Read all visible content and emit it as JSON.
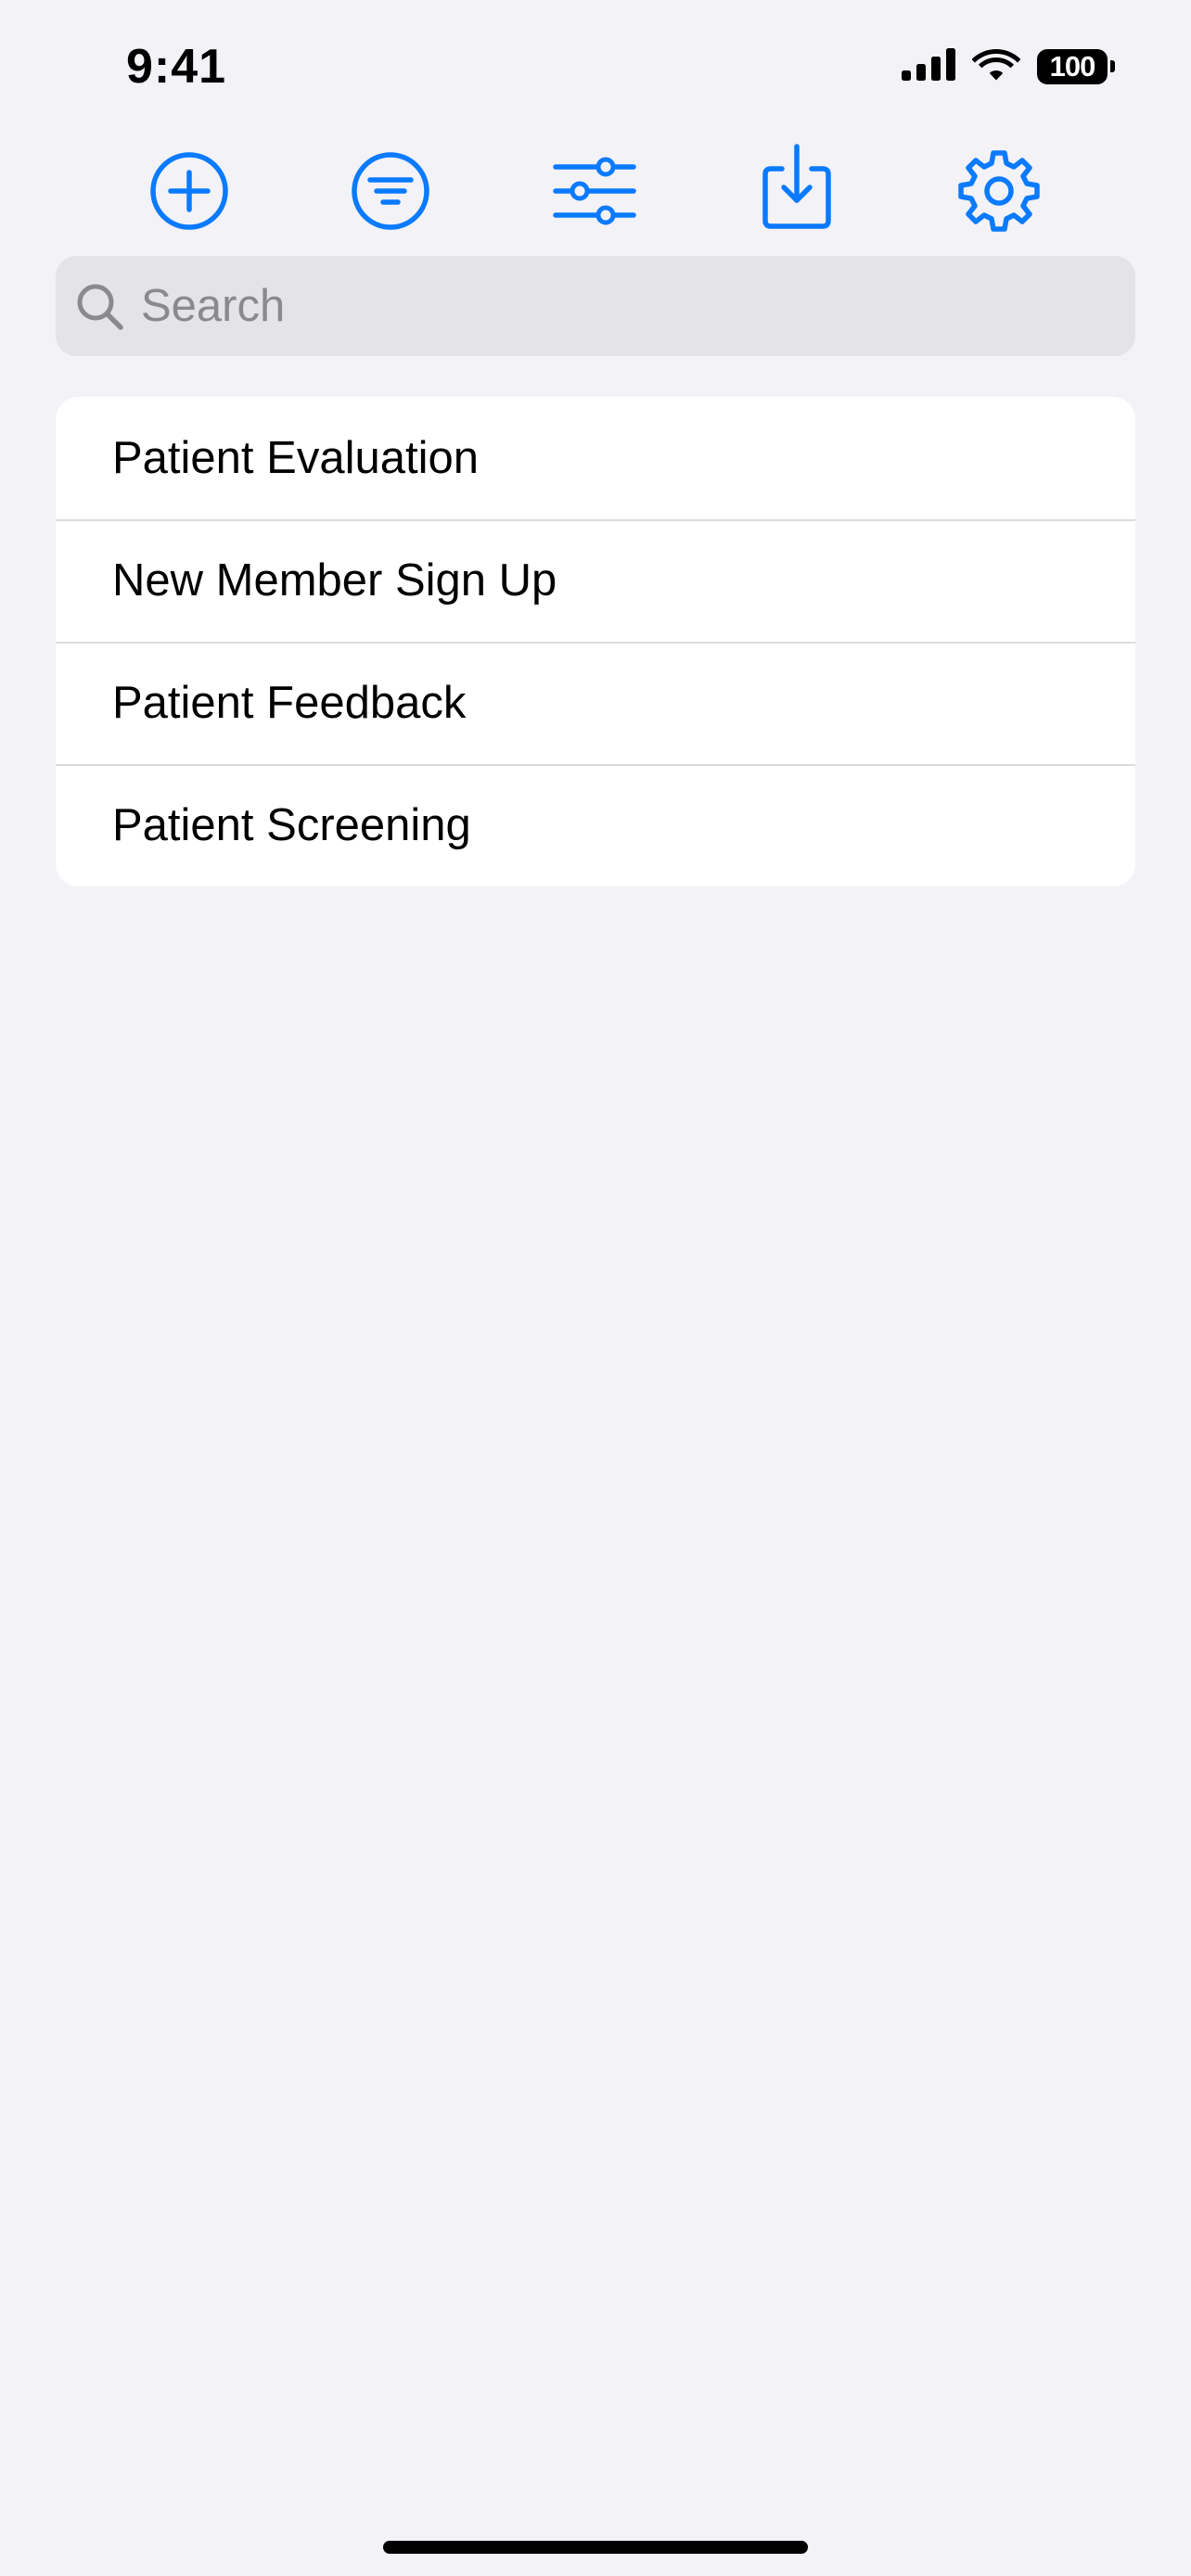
{
  "status_bar": {
    "time": "9:41",
    "battery": "100",
    "icons": [
      "cellular-signal-icon",
      "wifi-icon",
      "battery-icon"
    ]
  },
  "toolbar": {
    "accent_color": "#0a7aff",
    "buttons": [
      {
        "icon": "add-circle-icon"
      },
      {
        "icon": "filter-circle-icon"
      },
      {
        "icon": "sliders-icon"
      },
      {
        "icon": "download-tray-icon"
      },
      {
        "icon": "gear-icon"
      }
    ]
  },
  "search": {
    "placeholder": "Search",
    "value": ""
  },
  "forms": {
    "items": [
      {
        "label": "Patient Evaluation"
      },
      {
        "label": "New Member Sign Up"
      },
      {
        "label": "Patient Feedback"
      },
      {
        "label": "Patient Screening"
      }
    ]
  },
  "colors": {
    "background": "#f2f2f7",
    "card": "#ffffff",
    "separator": "#dcdce0",
    "search_field": "#e3e3e8"
  }
}
